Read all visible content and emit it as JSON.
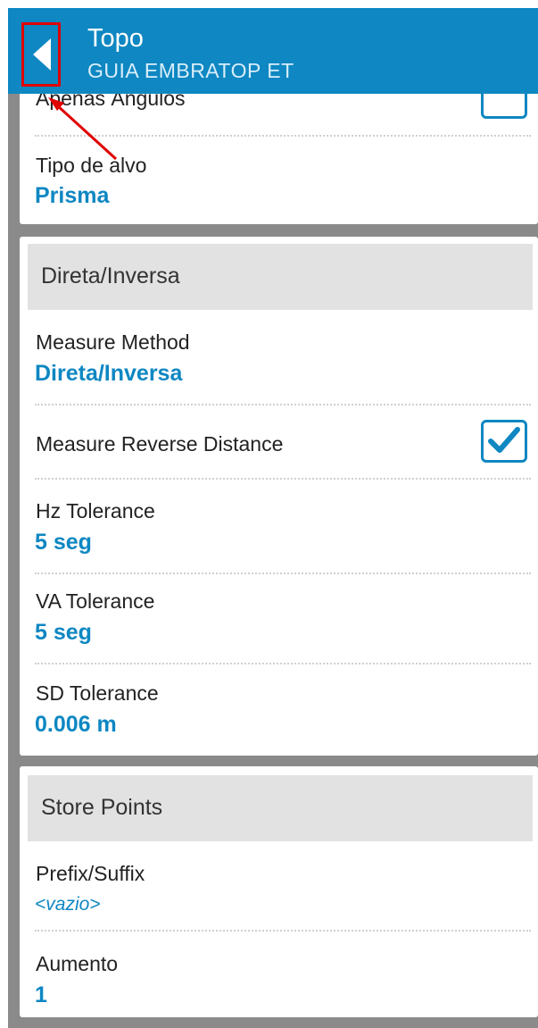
{
  "header": {
    "title": "Topo",
    "subtitle": "GUIA EMBRATOP ET"
  },
  "card1": {
    "angles_only_label": "Apenas Ângulos",
    "angles_only_checked": false,
    "target_type_label": "Tipo de alvo",
    "target_type_value": "Prisma"
  },
  "card2": {
    "section_title": "Direta/Inversa",
    "measure_method_label": "Measure Method",
    "measure_method_value": "Direta/Inversa",
    "reverse_distance_label": "Measure Reverse Distance",
    "reverse_distance_checked": true,
    "hz_tolerance_label": "Hz Tolerance",
    "hz_tolerance_value": "5 seg",
    "va_tolerance_label": "VA Tolerance",
    "va_tolerance_value": "5 seg",
    "sd_tolerance_label": "SD Tolerance",
    "sd_tolerance_value": "0.006 m"
  },
  "card3": {
    "section_title": "Store Points",
    "prefix_suffix_label": "Prefix/Suffix",
    "prefix_suffix_value": "<vazio>",
    "increment_label": "Aumento",
    "increment_value": "1"
  },
  "colors": {
    "accent": "#0e87c2",
    "annotation": "#e00000",
    "section_bg": "#e2e2e2",
    "backdrop": "#8a8a8a"
  }
}
